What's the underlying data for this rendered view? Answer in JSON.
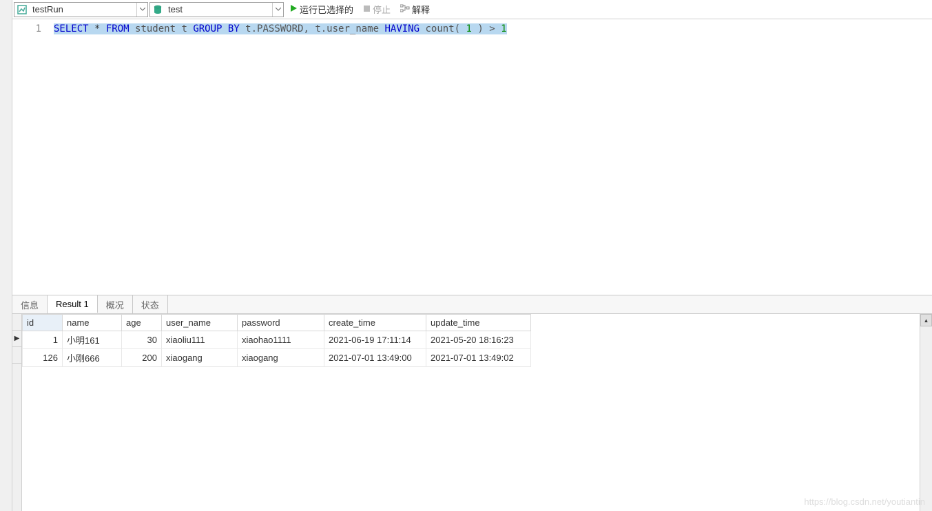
{
  "toolbar": {
    "connection": "testRun",
    "database": "test",
    "run_label": "运行已选择的",
    "stop_label": "停止",
    "explain_label": "解释"
  },
  "editor": {
    "line_number": "1",
    "sql": {
      "select": "SELECT",
      "star": " * ",
      "from": "FROM",
      "table": " student t ",
      "groupby": "GROUP BY",
      "cols": " t.PASSWORD, t.user_name ",
      "having": "HAVING",
      "func": " count( ",
      "one": "1",
      "rest": " ) > ",
      "one2": "1"
    }
  },
  "tabs": {
    "info": "信息",
    "result": "Result 1",
    "profile": "概况",
    "status": "状态"
  },
  "result": {
    "columns": [
      "id",
      "name",
      "age",
      "user_name",
      "password",
      "create_time",
      "update_time"
    ],
    "rows": [
      {
        "id": "1",
        "name": "小明161",
        "age": "30",
        "user_name": "xiaoliu111",
        "password": "xiaohao1111",
        "create_time": "2021-06-19 17:11:14",
        "update_time": "2021-05-20 18:16:23"
      },
      {
        "id": "126",
        "name": "小刚666",
        "age": "200",
        "user_name": "xiaogang",
        "password": "xiaogang",
        "create_time": "2021-07-01 13:49:00",
        "update_time": "2021-07-01 13:49:02"
      }
    ]
  },
  "watermark": "https://blog.csdn.net/youtiantin"
}
